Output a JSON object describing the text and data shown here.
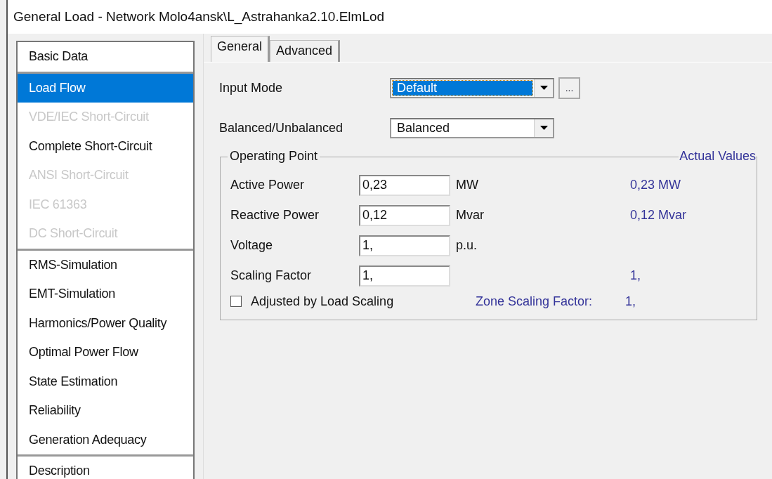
{
  "window": {
    "title": "General Load - Network Molo4ansk\\L_Astrahanka2.10.ElmLod"
  },
  "sidebar": {
    "groups": [
      {
        "items": [
          {
            "label": "Basic Data",
            "selected": false,
            "disabled": false
          }
        ]
      },
      {
        "items": [
          {
            "label": "Load Flow",
            "selected": true,
            "disabled": false
          },
          {
            "label": "VDE/IEC Short-Circuit",
            "selected": false,
            "disabled": true
          },
          {
            "label": "Complete Short-Circuit",
            "selected": false,
            "disabled": false
          },
          {
            "label": "ANSI Short-Circuit",
            "selected": false,
            "disabled": true
          },
          {
            "label": "IEC 61363",
            "selected": false,
            "disabled": true
          },
          {
            "label": "DC Short-Circuit",
            "selected": false,
            "disabled": true
          }
        ]
      },
      {
        "items": [
          {
            "label": "RMS-Simulation",
            "selected": false,
            "disabled": false
          },
          {
            "label": "EMT-Simulation",
            "selected": false,
            "disabled": false
          },
          {
            "label": "Harmonics/Power Quality",
            "selected": false,
            "disabled": false
          },
          {
            "label": "Optimal Power Flow",
            "selected": false,
            "disabled": false
          },
          {
            "label": "State Estimation",
            "selected": false,
            "disabled": false
          },
          {
            "label": "Reliability",
            "selected": false,
            "disabled": false
          },
          {
            "label": "Generation Adequacy",
            "selected": false,
            "disabled": false
          }
        ]
      },
      {
        "items": [
          {
            "label": "Description",
            "selected": false,
            "disabled": false
          }
        ]
      }
    ]
  },
  "tabs": [
    {
      "label": "General",
      "selected": true
    },
    {
      "label": "Advanced",
      "selected": false
    }
  ],
  "input_mode": {
    "label": "Input Mode",
    "value": "Default",
    "focused": true,
    "more_button": "..."
  },
  "balanced": {
    "label": "Balanced/Unbalanced",
    "value": "Balanced",
    "focused": false
  },
  "operating_point": {
    "title": "Operating Point",
    "actual_title": "Actual Values",
    "rows": [
      {
        "label": "Active Power",
        "value": "0,23",
        "unit": "MW",
        "actual": "0,23 MW"
      },
      {
        "label": "Reactive Power",
        "value": "0,12",
        "unit": "Mvar",
        "actual": "0,12 Mvar"
      },
      {
        "label": "Voltage",
        "value": "1,",
        "unit": "p.u."
      },
      {
        "label": "Scaling Factor",
        "value": "1,",
        "actual": "1,"
      }
    ],
    "load_scaling": {
      "label": "Adjusted by Load Scaling",
      "checked": false,
      "zone_label": "Zone Scaling Factor:",
      "zone_value": "1,"
    }
  }
}
